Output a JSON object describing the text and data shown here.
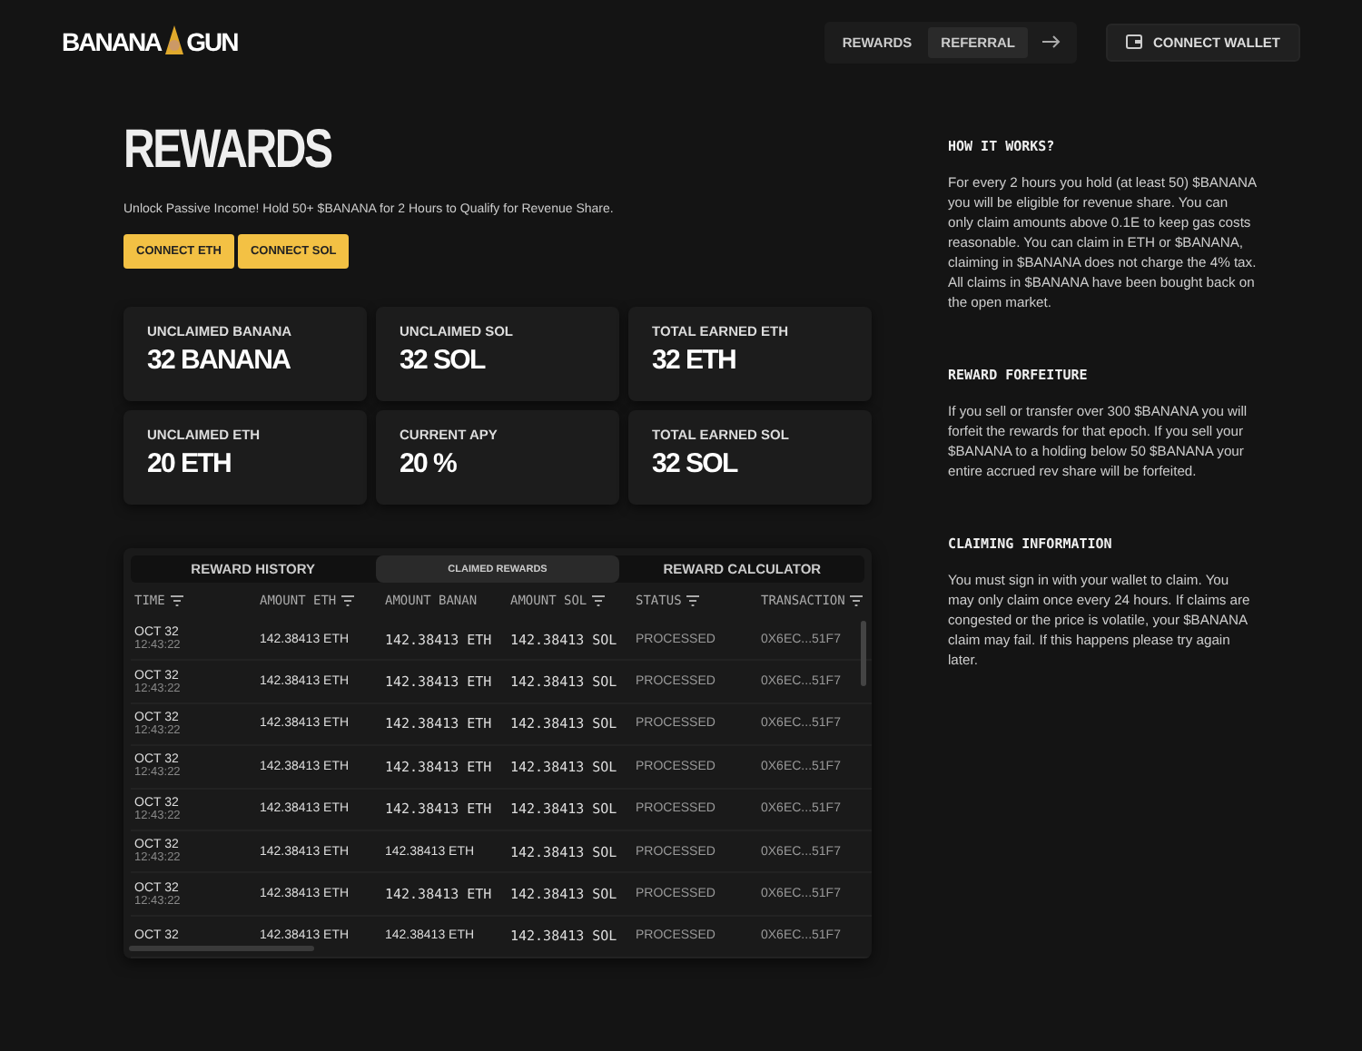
{
  "header": {
    "logo": [
      "BANANA",
      "GUN"
    ],
    "nav": [
      {
        "label": "REWARDS",
        "selected": false
      },
      {
        "label": "REFERRAL",
        "selected": true
      }
    ],
    "wallet_button": "CONNECT WALLET"
  },
  "title": "REWARDS",
  "subtitle": "Unlock Passive Income! Hold 50+ $BANANA for 2 Hours to Qualify for Revenue Share.",
  "connect_buttons": [
    "CONNECT ETH",
    "CONNECT SOL"
  ],
  "stats": [
    {
      "label": "UNCLAIMED BANANA",
      "value": "32 BANANA"
    },
    {
      "label": "UNCLAIMED SOL",
      "value": "32 SOL"
    },
    {
      "label": "TOTAL EARNED ETH",
      "value": "32 ETH"
    },
    {
      "label": "UNCLAIMED ETH",
      "value": "20 ETH"
    },
    {
      "label": "CURRENT APY",
      "value": "20 %"
    },
    {
      "label": "TOTAL EARNED SOL",
      "value": "32 SOL"
    }
  ],
  "table_tabs": [
    {
      "label": "REWARD HISTORY",
      "selected": false
    },
    {
      "label": "CLAIMED REWARDS",
      "selected": true
    },
    {
      "label": "REWARD CALCULATOR",
      "selected": false
    }
  ],
  "table": {
    "columns": [
      {
        "label": "TIME",
        "filter": true
      },
      {
        "label": "AMOUNT ETH",
        "filter": true
      },
      {
        "label": "AMOUNT BANAN",
        "filter": false
      },
      {
        "label": "AMOUNT SOL",
        "filter": true
      },
      {
        "label": "STATUS",
        "filter": true
      },
      {
        "label": "TRANSACTION",
        "filter": true
      }
    ],
    "rows": [
      {
        "date": "OCT 32",
        "time": "12:43:22",
        "eth": "142.38413 ETH",
        "banana": "142.38413 ETH",
        "banana_mono": true,
        "sol": "142.38413 SOL",
        "status": "PROCESSED",
        "tx": "0X6EC...51F7"
      },
      {
        "date": "OCT 32",
        "time": "12:43:22",
        "eth": "142.38413 ETH",
        "banana": "142.38413 ETH",
        "banana_mono": true,
        "sol": "142.38413 SOL",
        "status": "PROCESSED",
        "tx": "0X6EC...51F7"
      },
      {
        "date": "OCT 32",
        "time": "12:43:22",
        "eth": "142.38413 ETH",
        "banana": "142.38413 ETH",
        "banana_mono": true,
        "sol": "142.38413 SOL",
        "status": "PROCESSED",
        "tx": "0X6EC...51F7"
      },
      {
        "date": "OCT 32",
        "time": "12:43:22",
        "eth": "142.38413 ETH",
        "banana": "142.38413 ETH",
        "banana_mono": true,
        "sol": "142.38413 SOL",
        "status": "PROCESSED",
        "tx": "0X6EC...51F7"
      },
      {
        "date": "OCT 32",
        "time": "12:43:22",
        "eth": "142.38413 ETH",
        "banana": "142.38413 ETH",
        "banana_mono": true,
        "sol": "142.38413 SOL",
        "status": "PROCESSED",
        "tx": "0X6EC...51F7"
      },
      {
        "date": "OCT 32",
        "time": "12:43:22",
        "eth": "142.38413 ETH",
        "banana": "142.38413 ETH",
        "banana_mono": false,
        "sol": "142.38413 SOL",
        "status": "PROCESSED",
        "tx": "0X6EC...51F7"
      },
      {
        "date": "OCT 32",
        "time": "12:43:22",
        "eth": "142.38413 ETH",
        "banana": "142.38413 ETH",
        "banana_mono": true,
        "sol": "142.38413 SOL",
        "status": "PROCESSED",
        "tx": "0X6EC...51F7"
      },
      {
        "date": "OCT 32",
        "eth": "142.38413 ETH",
        "banana": "142.38413 ETH",
        "banana_mono": false,
        "sol": "142.38413 SOL",
        "status": "PROCESSED",
        "tx": "0X6EC...51F7"
      }
    ]
  },
  "info": [
    {
      "heading": "HOW IT WORKS?",
      "body": "For every 2 hours you hold (at least 50) $BANANA you will be eligible for revenue share. You can only claim amounts above 0.1E to keep gas costs reasonable. You can claim in ETH or $BANANA, claiming in $BANANA does not charge the 4% tax. All claims in $BANANA have been bought back on the open market."
    },
    {
      "heading": "REWARD FORFEITURE",
      "body": "If you sell or transfer over 300 $BANANA you will forfeit the rewards for that epoch. If you sell your $BANANA to a holding below 50 $BANANA your entire accrued rev share will be forfeited."
    },
    {
      "heading": "CLAIMING INFORMATION",
      "body": "You must sign in with your wallet to claim. You may only claim once every 24 hours. If claims are congested or the price is volatile, your $BANANA claim may fail. If this happens please try again later."
    }
  ]
}
